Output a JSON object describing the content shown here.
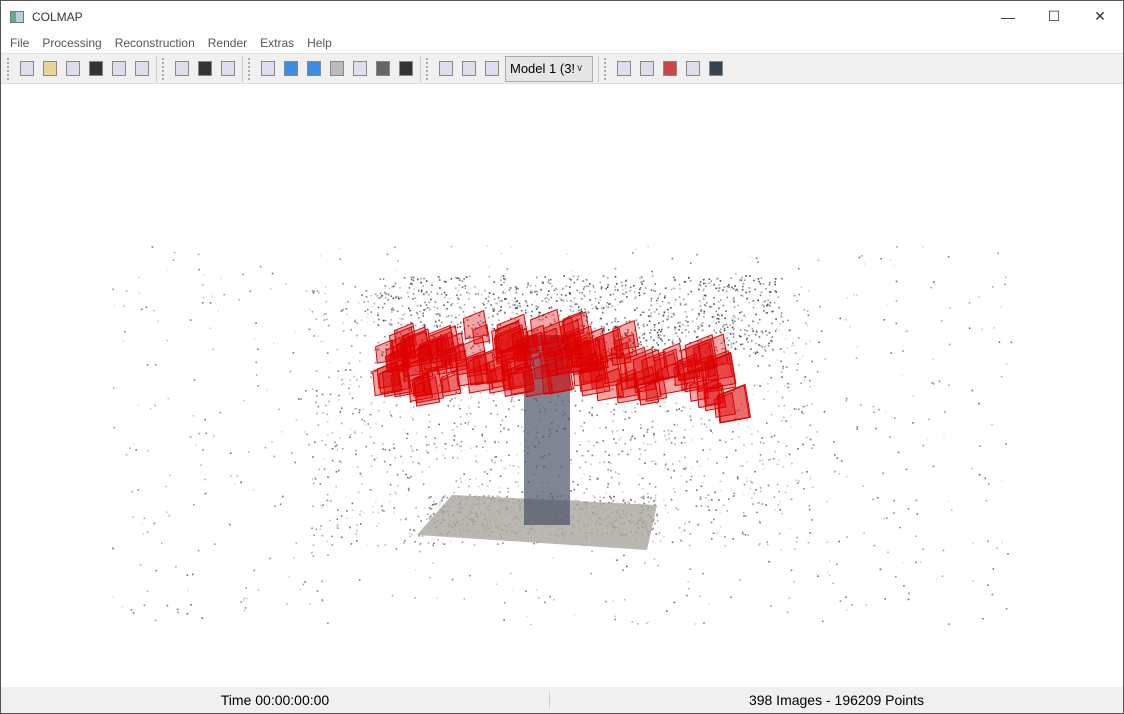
{
  "window": {
    "title": "COLMAP",
    "minimize": "—",
    "maximize": "☐",
    "close": "✕"
  },
  "menu": [
    "File",
    "Processing",
    "Reconstruction",
    "Render",
    "Extras",
    "Help"
  ],
  "toolbar": {
    "group1": [
      "new-project-icon",
      "open-project-icon",
      "edit-project-icon",
      "save-project-icon",
      "import-model-icon",
      "export-model-icon"
    ],
    "group2": [
      "database-management-icon",
      "grid-icon",
      "image-view-icon"
    ],
    "group3": [
      "automatic-reconstruction-icon",
      "play-icon",
      "step-icon",
      "pause-icon",
      "options-icon",
      "hammer-icon",
      "render-options-icon"
    ],
    "group4": [
      "dense-import-icon",
      "dense-export-icon",
      "network-icon"
    ],
    "model_select": "Model 1 (3!",
    "group5": [
      "log-icon",
      "matches-grid-icon",
      "stats-icon",
      "screenshot-icon",
      "movie-icon"
    ]
  },
  "colors": {
    "cameras": "#dd0000"
  },
  "status": {
    "time": "Time 00:00:00:00",
    "summary": "398 Images - 196209 Points"
  }
}
